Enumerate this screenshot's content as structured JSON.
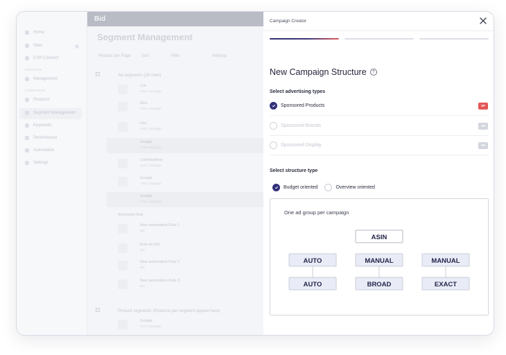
{
  "background_app": {
    "logo": "Bid",
    "page_title": "Segment Management",
    "nav_items": [
      "Home",
      "Sites",
      "CSP Connect",
      "Management",
      "Products",
      "Segment Management",
      "Keywords",
      "Performance",
      "Automation",
      "Settings"
    ],
    "nav_sections": [
      "SOURCES",
      "CAMPAIGNS"
    ],
    "tools": [
      "Product per Page",
      "Sort",
      "Filter",
      "Settings"
    ],
    "ad_segments_header": "Ad segments",
    "ad_segments_count": "(28 rows)",
    "rows": [
      {
        "name": "Cot",
        "sub": "Auto Campaign"
      },
      {
        "name": "Asin",
        "sub": "Auto Campaign"
      },
      {
        "name": "Hey",
        "sub": "Auto Campaign"
      },
      {
        "name": "Google",
        "sub": "Auto Campaign"
      },
      {
        "name": "Contributions",
        "sub": "Auto Campaign"
      },
      {
        "name": "Google",
        "sub": "Auto Campaign"
      },
      {
        "name": "Google",
        "sub": "Auto Campaign"
      }
    ],
    "sub_section_label": "Automation Rule",
    "sub_rows": [
      {
        "name": "New automation Rule 1",
        "sub": "Bid"
      },
      {
        "name": "Rule for bid",
        "sub": "Bid"
      },
      {
        "name": "New automation Rule 2",
        "sub": "Bid"
      },
      {
        "name": "New automation Rule 3",
        "sub": "Bid"
      }
    ],
    "product_segments_header": "Product segments",
    "product_segments_note": "(Products per segment appear here)",
    "product_row": {
      "name": "Google",
      "sub": "Auto Campaign"
    }
  },
  "panel": {
    "title": "Campaign Creator",
    "close_icon": "close-icon",
    "steps": [
      {
        "state": "active"
      },
      {
        "state": "inactive"
      },
      {
        "state": "inactive"
      }
    ],
    "heading": "New Campaign Structure",
    "help_glyph": "?",
    "ad_types_label": "Select advertising types",
    "ad_types": [
      {
        "label": "Sponsored Products",
        "tag": "SP",
        "selected": true
      },
      {
        "label": "Sponsored Brands",
        "tag": "SB",
        "selected": false
      },
      {
        "label": "Sponsored Display",
        "tag": "SD",
        "selected": false
      }
    ],
    "structure_label": "Select structure type",
    "structure_options": [
      {
        "label": "Budget oriented",
        "selected": true
      },
      {
        "label": "Overview oriented",
        "selected": false
      }
    ],
    "diagram": {
      "caption": "One ad group per campaign",
      "root": "ASIN",
      "columns": [
        {
          "top": "AUTO",
          "bottom": "AUTO"
        },
        {
          "top": "MANUAL",
          "bottom": "BROAD"
        },
        {
          "top": "MANUAL",
          "bottom": "EXACT"
        }
      ]
    }
  },
  "colors": {
    "accent": "#33307a",
    "sp_tag": "#e45555",
    "node_fill": "#e9ebf6",
    "node_stroke": "#c9ccd8"
  }
}
